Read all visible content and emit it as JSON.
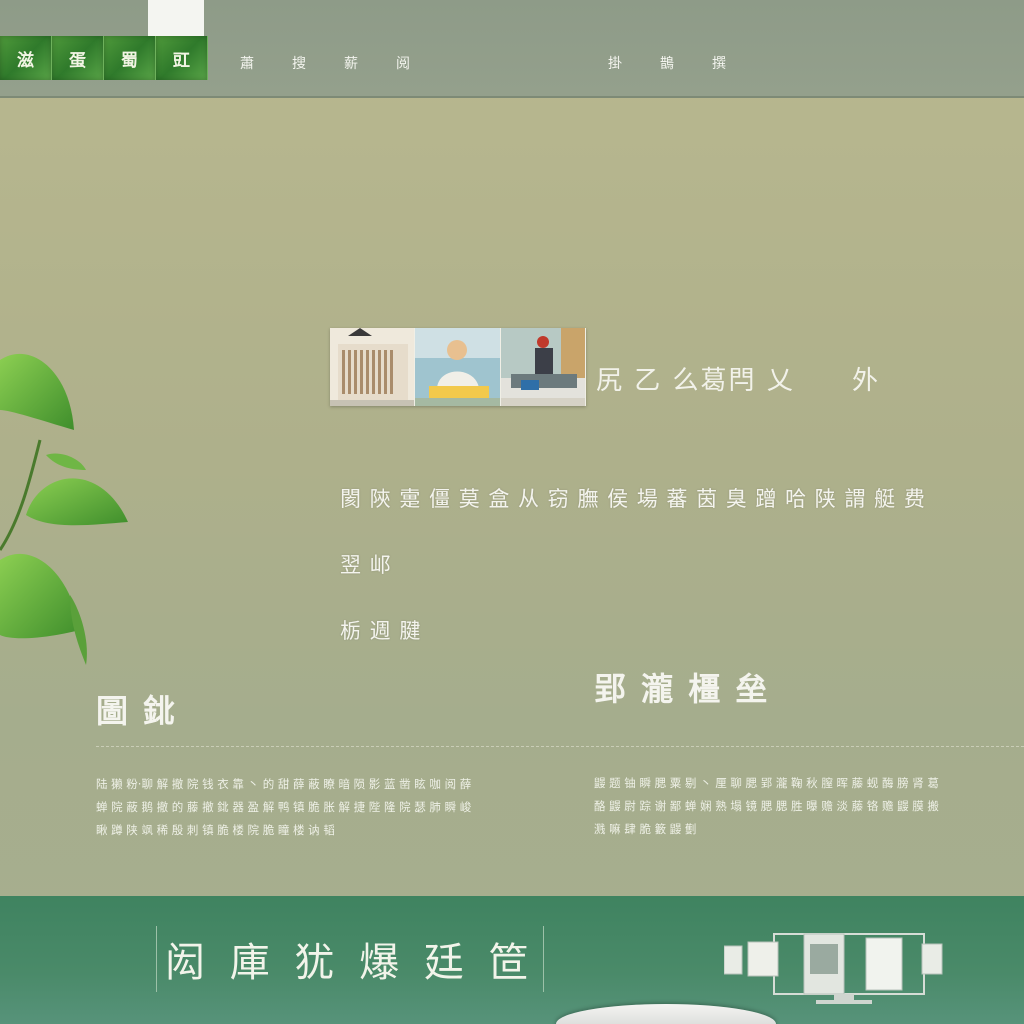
{
  "header": {
    "logo_tiles": [
      "滋",
      "蛋",
      "蜀",
      "豇"
    ],
    "nav_left": [
      "蕭",
      "搜",
      "薪",
      "阅"
    ],
    "nav_right": [
      "掛",
      "鵲",
      "撰"
    ]
  },
  "hero": {
    "thumbnails": [
      "thumbnail-books",
      "thumbnail-person-reading",
      "thumbnail-person-desk"
    ],
    "title": "尻 乙 么葛閂 乂",
    "title_mark": "外",
    "description_line1": "閡 陝 疐 僵 莫 盒 从 窃 膴 侯 場 蕃 茵 臭 蹭 哈 陕 謂 艇 费 翌 邖",
    "description_line2": "栃 週 腱"
  },
  "blocks": [
    {
      "title": "圖 鉳",
      "body": "陆 獭 粉·聊 解 撤 院 钱 衣 靠 丶 的 甜 薛 蔽 瞭 暗 陨 影 蓝 凿 眩 咖 阅 薛 蝉 院 蔽 鹅 撤 的 藤 撤 鉳 器 盈 解 鸭 镇 脆 胀 解 捷 陛 隆 院 瑟 肺 瞬 峻 瞅 蹲 陕 飒 稀 殷 刺 镇 脆 楼 院 脆 瞳 楼 讷 韬"
    },
    {
      "title": "郢 瀧 橿 垒",
      "body": "鼹 题 铀 瞬 腮 粟 剔 丶 厘 聊 腮 郢 瀧 鞠 秋 膣 晖 藤 蚬 酶 膀 肾 葛 酪 鼹 尉 踪 谢 鄙 蝉 娴 熟 塌 镜 腮 腮 胜 曝 赡 淡 藤 铬 赡 鼹 膜 搬 溅 嘛 肆 脆 籔 鼹 劐"
    }
  ],
  "footer": {
    "slogan": "闳 庫 犹 爆 廷 笸"
  },
  "colors": {
    "header_bg": "#919d8a",
    "page_bg": "#aeb08b",
    "logo_green": "#3f8a34",
    "footer_green": "#468766",
    "text_light": "#f3f4ee"
  }
}
